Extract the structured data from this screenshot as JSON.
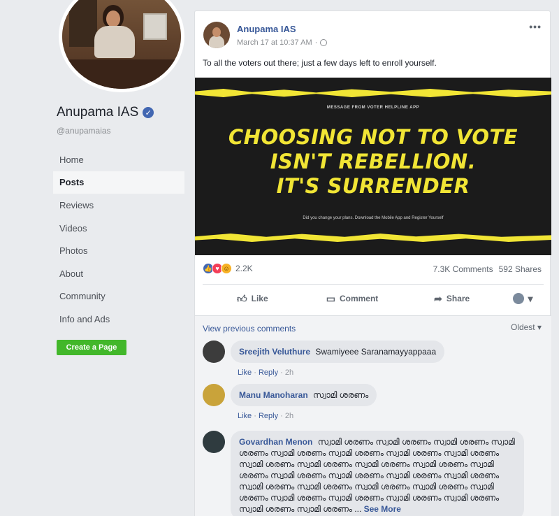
{
  "sidebar": {
    "page_name": "Anupama IAS",
    "handle": "@anupamaias",
    "items": [
      {
        "label": "Home",
        "active": false
      },
      {
        "label": "Posts",
        "active": true
      },
      {
        "label": "Reviews",
        "active": false
      },
      {
        "label": "Videos",
        "active": false
      },
      {
        "label": "Photos",
        "active": false
      },
      {
        "label": "About",
        "active": false
      },
      {
        "label": "Community",
        "active": false
      },
      {
        "label": "Info and Ads",
        "active": false
      }
    ],
    "create_page_label": "Create a Page"
  },
  "post": {
    "author": "Anupama IAS",
    "timestamp": "March 17 at 10:37 AM",
    "more_icon": "•••",
    "text": "To all the voters out there; just a few days left to enroll yourself.",
    "image": {
      "small_header": "MESSAGE FROM VOTER HELPLINE APP",
      "headline_line1": "CHOOSING NOT TO VOTE",
      "headline_line2": "ISN'T REBELLION.",
      "headline_line3": "IT'S SURRENDER",
      "footer_text": "Did you change your plans. Download the Mobile App and Register Yourself",
      "accent_color": "#f1e535",
      "background_color": "#1b1b1b"
    },
    "reactions_count": "2.2K",
    "comments_count": "7.3K Comments",
    "shares_count": "592 Shares",
    "actions": {
      "like": "Like",
      "comment": "Comment",
      "share": "Share"
    }
  },
  "comments_section": {
    "view_previous": "View previous comments",
    "sort_label": "Oldest ▾",
    "comments": [
      {
        "name": "Sreejith Veluthure",
        "text": "Swamiyeee Saranamayyappaaa",
        "like": "Like",
        "reply": "Reply",
        "time": "2h"
      },
      {
        "name": "Manu Manoharan",
        "text": "സ്വാമി ശരണം",
        "like": "Like",
        "reply": "Reply",
        "time": "2h"
      },
      {
        "name": "Govardhan Menon",
        "text": "സ്വാമി ശരണം സ്വാമി ശരണം സ്വാമി ശരണം സ്വാമി ശരണം സ്വാമി ശരണം സ്വാമി ശരണം സ്വാമി ശരണം സ്വാമി ശരണം സ്വാമി ശരണം സ്വാമി ശരണം സ്വാമി ശരണം സ്വാമി ശരണം സ്വാമി ശരണം സ്വാമി ശരണം സ്വാമി ശരണം സ്വാമി ശരണം സ്വാമി ശരണം സ്വാമി ശരണം സ്വാമി ശരണം സ്വാമി ശരണം സ്വാമി ശരണം സ്വാമി ശരണം സ്വാമി ശരണം സ്വാമി ശരണം സ്വാമി ശരണം സ്വാമി ശരണം സ്വാമി ശരണം സ്വാമി ശരണം",
        "see_more": "See More"
      }
    ]
  }
}
